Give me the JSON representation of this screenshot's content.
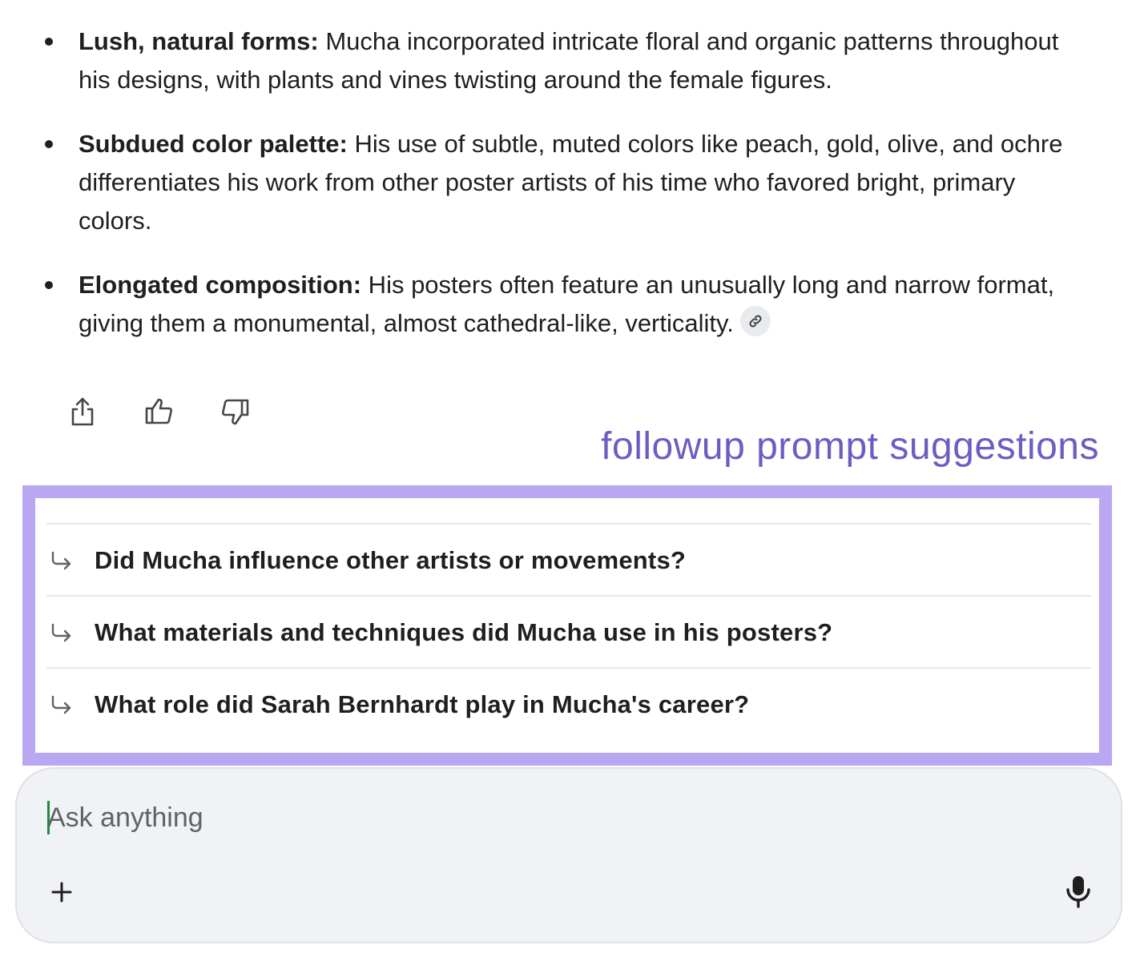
{
  "response": {
    "bullets": [
      {
        "term": "Lush, natural forms:",
        "text": " Mucha incorporated intricate floral and organic patterns throughout his designs, with plants and vines twisting around the female figures."
      },
      {
        "term": "Subdued color palette:",
        "text": " His use of subtle, muted colors like peach, gold, olive, and ochre differentiates his work from other poster artists of his time who favored bright, primary colors."
      },
      {
        "term": "Elongated composition:",
        "text": " His posters often feature an unusually long and narrow format, giving them a monumental, almost cathedral-like, verticality."
      }
    ],
    "source_icon": "link-icon"
  },
  "actions": {
    "share_icon": "share-icon",
    "thumbs_up_icon": "thumbs-up-icon",
    "thumbs_down_icon": "thumbs-down-icon"
  },
  "annotation": {
    "label": "followup prompt suggestions",
    "color": "#6f5bc4",
    "frame_color": "#b9a7f2"
  },
  "suggestions": [
    {
      "text": "Did Mucha influence other artists or movements?",
      "icon": "reply-arrow-icon"
    },
    {
      "text": "What materials and techniques did Mucha use in his posters?",
      "icon": "reply-arrow-icon"
    },
    {
      "text": "What role did Sarah Bernhardt play in Mucha's career?",
      "icon": "reply-arrow-icon"
    }
  ],
  "composer": {
    "placeholder": "Ask anything",
    "value": "",
    "add_icon": "plus-icon",
    "mic_icon": "microphone-icon"
  }
}
